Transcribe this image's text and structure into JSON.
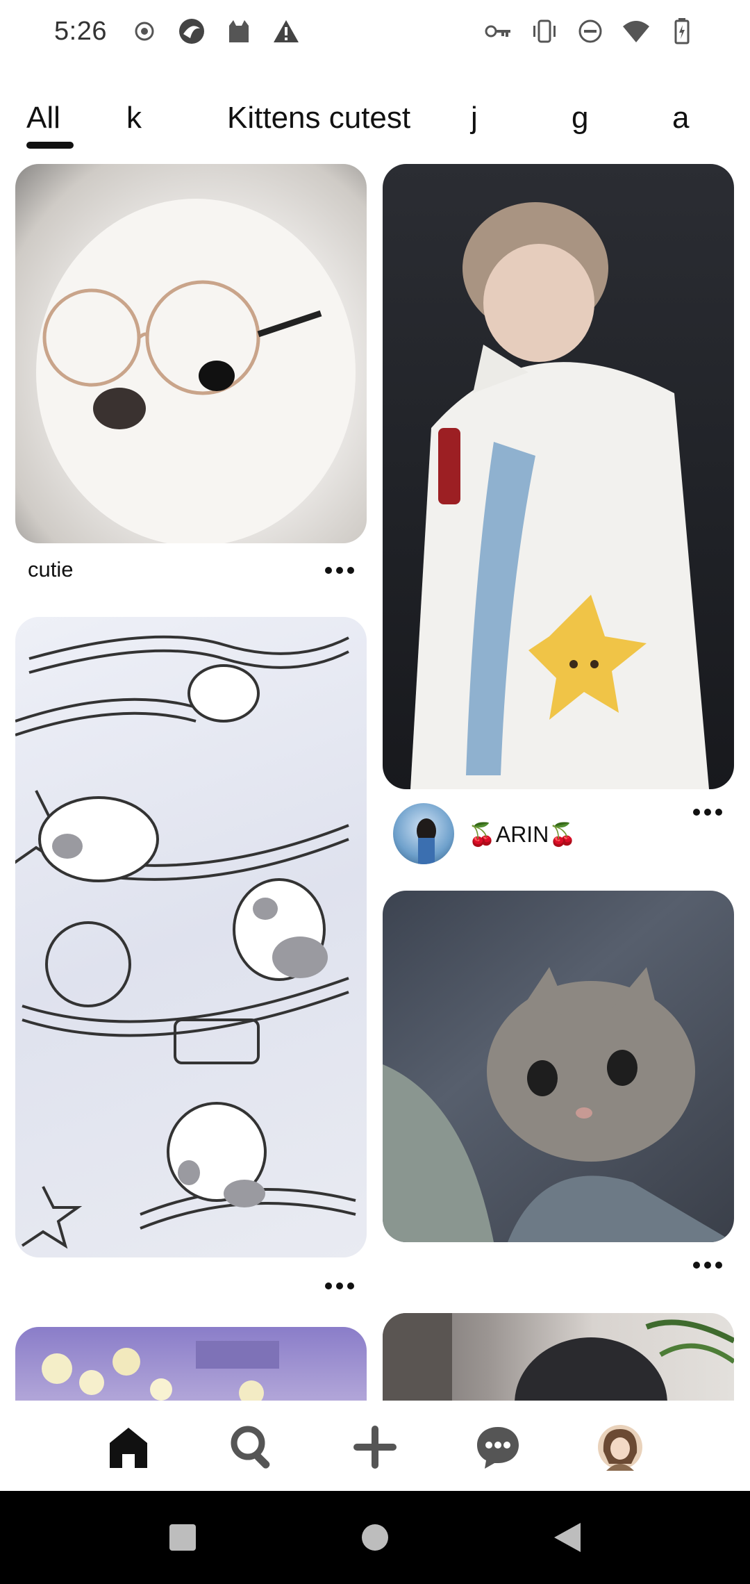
{
  "status_bar": {
    "time": "5:26",
    "left_icons": [
      "record-icon",
      "app-icon",
      "cat-app-icon",
      "warning-icon"
    ],
    "right_icons": [
      "key-icon",
      "vibrate-icon",
      "do-not-disturb-icon",
      "wifi-icon",
      "battery-icon"
    ]
  },
  "tabs": {
    "items": [
      {
        "label": "All",
        "selected": true
      },
      {
        "label": "k"
      },
      {
        "label": "Kittens cutest"
      },
      {
        "label": "j"
      },
      {
        "label": "g"
      },
      {
        "label": "a"
      }
    ]
  },
  "pins": {
    "left": [
      {
        "title": "cutie",
        "image": "white dog with round glasses"
      },
      {
        "title": "",
        "image": "cat doodle illustration"
      },
      {
        "title": "",
        "image": "flowers and city"
      }
    ],
    "right": [
      {
        "creator": "🍒ARIN🍒",
        "image": "man in white coat with plush toy"
      },
      {
        "title": "",
        "image": "grey kitten in denim jacket"
      },
      {
        "title": "",
        "image": "person with plant"
      }
    ]
  },
  "bottom_nav": {
    "items": [
      "home-icon",
      "search-icon",
      "add-icon",
      "messages-icon",
      "profile-avatar"
    ]
  },
  "system_nav": {
    "items": [
      "recent-apps-icon",
      "home-button-icon",
      "back-icon"
    ]
  },
  "colors": {
    "text": "#111111",
    "background": "#ffffff",
    "system_bar": "#000000"
  }
}
